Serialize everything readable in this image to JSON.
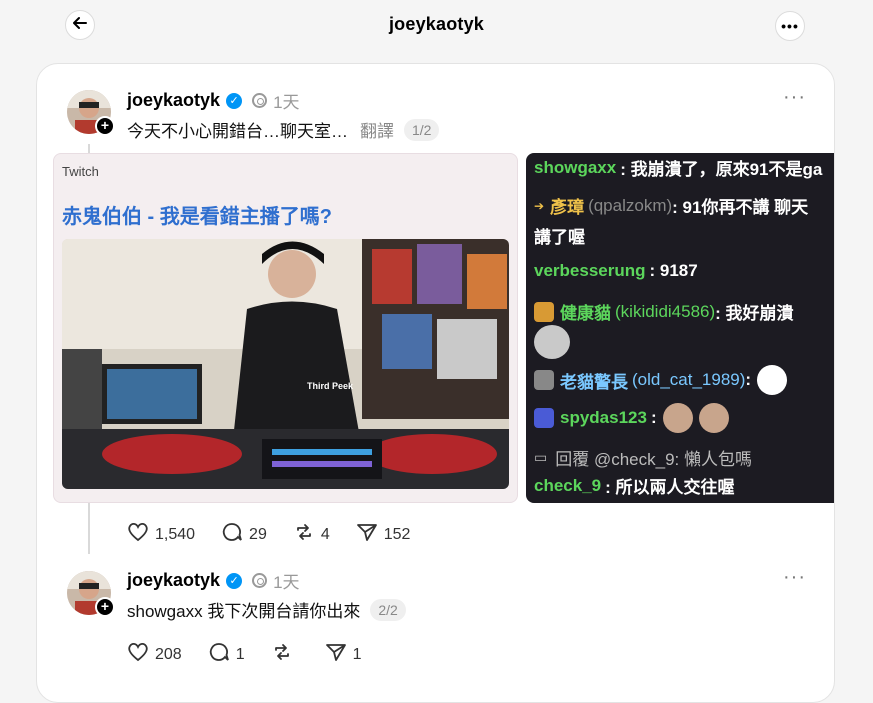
{
  "header": {
    "title": "joeykaotyk"
  },
  "post1": {
    "username": "joeykaotyk",
    "time": "1天",
    "text": "今天不小心開錯台…聊天室…",
    "translate": "翻譯",
    "pager": "1/2",
    "media1": {
      "source_label": "Twitch",
      "title": "赤鬼伯伯 - 我是看錯主播了嗎?",
      "shirt_text": "Third Peek"
    },
    "chat": [
      {
        "name": "showgaxx",
        "text": ": 我崩潰了，原來91不是ga",
        "color": "#5cd65c"
      },
      {
        "name": "彥璋",
        "sub": "(qpalzokm)",
        "text": ": 91你再不講 聊天",
        "color": "#f0c24a"
      },
      {
        "name": "",
        "text": "講了喔",
        "color": "#ffffff"
      },
      {
        "name": "verbesserung",
        "text": ": 9187",
        "color": "#5cd65c"
      },
      {
        "name": "健康貓",
        "sub": "(kikididi4586)",
        "text": ": 我好崩潰",
        "color": "#5cd65c"
      },
      {
        "name": "老貓警長",
        "sub": "(old_cat_1989)",
        "text": ":",
        "color": "#7ac8ff"
      },
      {
        "name": "spydas123",
        "text": ":",
        "color": "#5cd65c"
      },
      {
        "name": "回覆 @check_9",
        "text": ": 懶人包嗎",
        "color": "#bbbbbb"
      },
      {
        "name": "check_9",
        "text": ": 所以兩人交往喔",
        "color": "#5cd65c"
      }
    ],
    "stats": {
      "likes": "1,540",
      "comments": "29",
      "reposts": "4",
      "shares": "152"
    }
  },
  "post2": {
    "username": "joeykaotyk",
    "time": "1天",
    "text": "showgaxx 我下次開台請你出來",
    "pager": "2/2",
    "stats": {
      "likes": "208",
      "comments": "1",
      "reposts": "",
      "shares": "1"
    }
  },
  "colors": {
    "verified": "#0095f6",
    "twitch_title": "#2f6fcf",
    "chat_bg": "#1c1b22"
  }
}
